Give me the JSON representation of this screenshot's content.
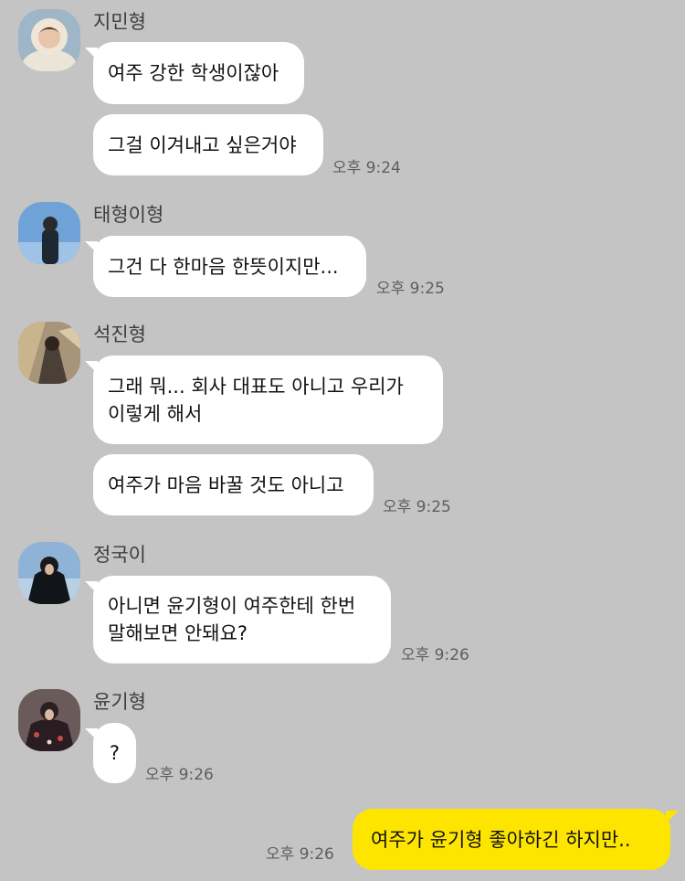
{
  "messages": [
    {
      "sender": "지민형",
      "avatar_icon": "profile-photo-jimin",
      "bubbles": [
        "여주 강한 학생이잖아",
        "그걸 이겨내고 싶은거야"
      ],
      "time": "오후 9:24"
    },
    {
      "sender": "태형이형",
      "avatar_icon": "profile-photo-taehyung",
      "bubbles": [
        "그건 다 한마음 한뜻이지만..."
      ],
      "time": "오후 9:25"
    },
    {
      "sender": "석진형",
      "avatar_icon": "profile-photo-seokjin",
      "bubbles": [
        "그래 뭐... 회사 대표도 아니고 우리가\n이렇게 해서",
        "여주가 마음 바꿀 것도 아니고"
      ],
      "time": "오후 9:25"
    },
    {
      "sender": "정국이",
      "avatar_icon": "profile-photo-jungkook",
      "bubbles": [
        "아니면 윤기형이 여주한테 한번\n말해보면 안돼요?"
      ],
      "time": "오후 9:26"
    },
    {
      "sender": "윤기형",
      "avatar_icon": "profile-photo-yoongi",
      "bubbles": [
        "?"
      ],
      "time": "오후 9:26"
    }
  ],
  "my_message": {
    "text": "여주가 윤기형 좋아하긴 하지만..",
    "time": "오후 9:26"
  },
  "colors": {
    "background": "#c4c4c4",
    "incoming_bubble": "#ffffff",
    "outgoing_bubble": "#fee500"
  }
}
